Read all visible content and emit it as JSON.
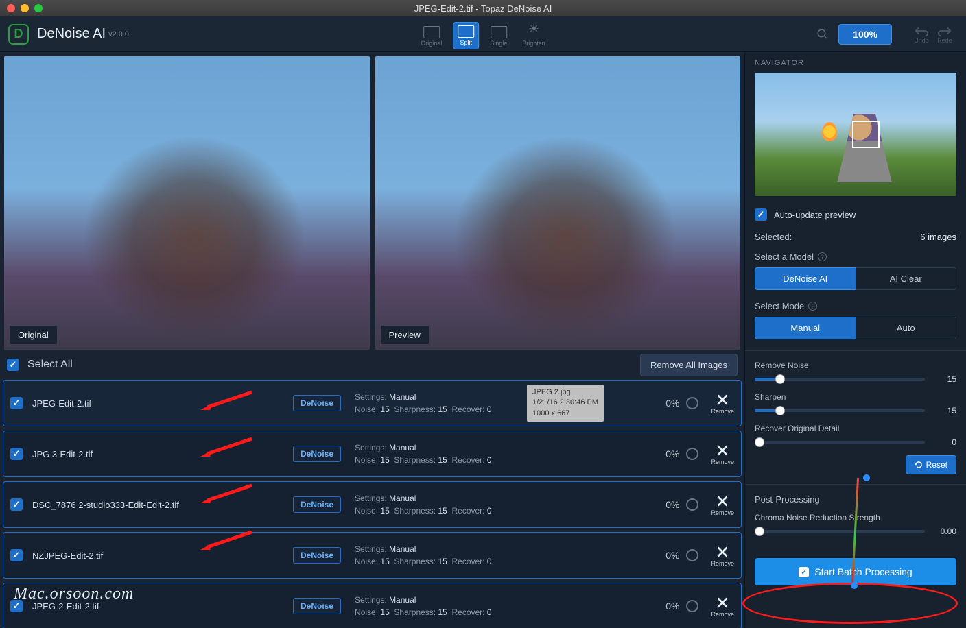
{
  "titlebar": {
    "title": "JPEG-Edit-2.tif - Topaz DeNoise AI"
  },
  "app": {
    "name": "DeNoise AI",
    "version": "v2.0.0"
  },
  "toolbar": {
    "modes": {
      "original": "Original",
      "split": "Split",
      "single": "Single",
      "brighten": "Brighten"
    },
    "zoom": "100%",
    "undo": "Undo",
    "redo": "Redo"
  },
  "preview": {
    "original_label": "Original",
    "preview_label": "Preview"
  },
  "selectbar": {
    "select_all": "Select All",
    "remove_all": "Remove All Images"
  },
  "meta_labels": {
    "settings": "Settings:",
    "noise": "Noise:",
    "sharpness": "Sharpness:",
    "recover": "Recover:",
    "remove": "Remove"
  },
  "rows": [
    {
      "name": "JPEG-Edit-2.tif",
      "settings": "Manual",
      "noise": "15",
      "sharpness": "15",
      "recover": "0",
      "pct": "0%",
      "tooltip": {
        "l1": "JPEG 2.jpg",
        "l2": "1/21/16 2:30:46 PM",
        "l3": "1000 x 667"
      }
    },
    {
      "name": "JPG 3-Edit-2.tif",
      "settings": "Manual",
      "noise": "15",
      "sharpness": "15",
      "recover": "0",
      "pct": "0%"
    },
    {
      "name": "DSC_7876 2-studio333-Edit-Edit-2.tif",
      "settings": "Manual",
      "noise": "15",
      "sharpness": "15",
      "recover": "0",
      "pct": "0%"
    },
    {
      "name": "NZJPEG-Edit-2.tif",
      "settings": "Manual",
      "noise": "15",
      "sharpness": "15",
      "recover": "0",
      "pct": "0%"
    },
    {
      "name": "JPEG-2-Edit-2.tif",
      "settings": "Manual",
      "noise": "15",
      "sharpness": "15",
      "recover": "0",
      "pct": "0%"
    }
  ],
  "denoise_btn": "DeNoise",
  "sidebar": {
    "navigator": "NAVIGATOR",
    "auto_update": "Auto-update preview",
    "selected_label": "Selected:",
    "selected_value": "6 images",
    "select_model": "Select a Model",
    "model_a": "DeNoise AI",
    "model_b": "AI Clear",
    "select_mode": "Select Mode",
    "mode_a": "Manual",
    "mode_b": "Auto",
    "remove_noise": {
      "label": "Remove Noise",
      "value": "15",
      "fill": 15
    },
    "sharpen": {
      "label": "Sharpen",
      "value": "15",
      "fill": 15
    },
    "recover": {
      "label": "Recover Original Detail",
      "value": "0",
      "fill": 0
    },
    "reset": "Reset",
    "post_processing": "Post-Processing",
    "chroma": {
      "label": "Chroma Noise Reduction Strength",
      "value": "0.00",
      "fill": 0
    },
    "start": "Start Batch Processing"
  },
  "watermark": "Mac.orsoon.com"
}
